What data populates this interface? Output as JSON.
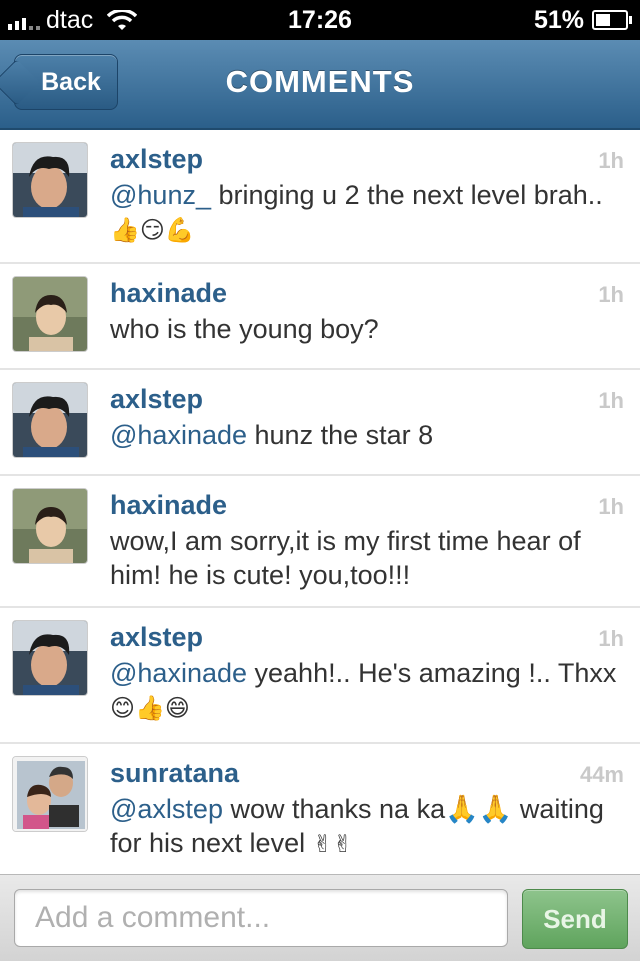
{
  "status_bar": {
    "carrier": "dtac",
    "time": "17:26",
    "battery": "51%"
  },
  "nav": {
    "back_label": "Back",
    "title": "COMMENTS"
  },
  "comments": [
    {
      "username": "axlstep",
      "timestamp": "1h",
      "mention": "@hunz_",
      "text": " bringing u 2 the next level brah..",
      "emoji": "👍😏💪"
    },
    {
      "username": "haxinade",
      "timestamp": "1h",
      "mention": "",
      "text": "who is the young boy?",
      "emoji": ""
    },
    {
      "username": "axlstep",
      "timestamp": "1h",
      "mention": "@haxinade",
      "text": " hunz the star 8",
      "emoji": ""
    },
    {
      "username": "haxinade",
      "timestamp": "1h",
      "mention": "",
      "text": "wow,I am sorry,it is my first time  hear of him! he is cute! you,too!!!",
      "emoji": ""
    },
    {
      "username": "axlstep",
      "timestamp": "1h",
      "mention": "@haxinade",
      "text": " yeahh!.. He's amazing !.. Thxx",
      "emoji": "😊👍😄"
    },
    {
      "username": "sunratana",
      "timestamp": "44m",
      "mention": "@axlstep",
      "text": " wow thanks na ka🙏🙏 waiting for his next level ",
      "emoji": "✌✌"
    }
  ],
  "compose": {
    "placeholder": "Add a comment...",
    "send_label": "Send"
  },
  "colors": {
    "nav_top": "#5b8cb3",
    "nav_bottom": "#2b5f8a",
    "username": "#2c5f8a",
    "send_button": "#6aad67"
  }
}
